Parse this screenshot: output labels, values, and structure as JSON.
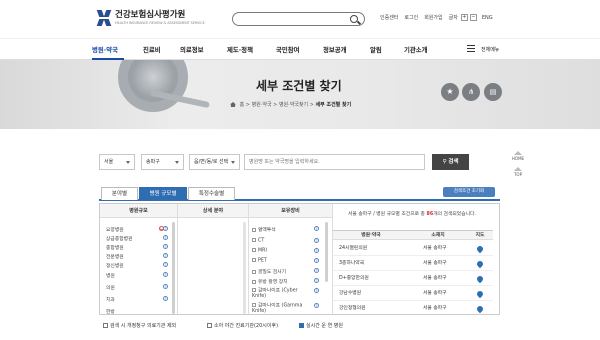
{
  "header": {
    "logo_text": "건강보험심사평가원",
    "logo_sub": "HEALTH INSURANCE REVIEW & ASSESSMENT SERVICE",
    "search_placeholder": "",
    "util": [
      "인증센터",
      "로그인",
      "회원가입",
      "글자"
    ],
    "zoom_plus": "+",
    "zoom_minus": "−",
    "lang": "ENG"
  },
  "nav": {
    "items": [
      "병원·약국",
      "진료비",
      "의료정보",
      "제도·정책",
      "국민참여",
      "정보공개",
      "알림",
      "기관소개"
    ],
    "all_menu": "전체메뉴",
    "active_index": 0
  },
  "banner": {
    "title": "세부 조건별 찾기",
    "breadcrumb": [
      "홈",
      "병원·약국",
      "병원·약국찾기",
      "세부 조건별 찾기"
    ],
    "actions": [
      "star-icon",
      "share-icon",
      "print-icon"
    ]
  },
  "filter": {
    "region1": "서울",
    "region2": "송파구",
    "region3": "읍/면/동/로 선택",
    "keyword_placeholder": "병원명 또는 약국명을 입력하세요.",
    "search_button": "검색"
  },
  "side": {
    "home": "HOME",
    "top": "TOP"
  },
  "tabs": {
    "items": [
      "분야별",
      "병원 규모별",
      "특정수술별"
    ],
    "active_index": 1,
    "reset_button": "검색조건 초기화"
  },
  "panel": {
    "col_headers": [
      "병원규모",
      "상세 분야",
      "보유장비"
    ],
    "sizes": [
      "요양병원",
      "상급종합병원",
      "종합병원",
      "전문병원",
      "정신병원",
      "병원",
      "의원",
      "치과",
      "한방"
    ],
    "equipment": [
      "혈액투석",
      "CT",
      "MRI",
      "PET",
      "골밀도 검사기",
      "유방 촬영 장치",
      "감마나이프 (Cyber Knife)",
      "감마나이프 (Gamma Knife)"
    ],
    "result_text_prefix": "서울 송파구 / 병원 규모별 조건으로 총 ",
    "result_count": "86",
    "result_text_suffix": "개의 검색되었습니다.",
    "result_headers": [
      "병원·약국",
      "소재지",
      "지도"
    ],
    "results": [
      {
        "name": "24시열린의원",
        "addr": "서울 송파구"
      },
      {
        "name": "3층하나약국",
        "addr": "서울 송파구"
      },
      {
        "name": "D+중앙한의원",
        "addr": "서울 송파구"
      },
      {
        "name": "강남수병원",
        "addr": "서울 송파구"
      },
      {
        "name": "강인정형의원",
        "addr": "서울 송파구"
      }
    ]
  },
  "bottom": {
    "opt1": "검색 시 개정청구 의료기관 제외",
    "opt2": "소아 야간 진료기관(20시이후)",
    "opt3": "실시간 운 연 병원",
    "opt3_checked": true
  },
  "colors": {
    "primary": "#2f6db3",
    "nav_active": "#1c4aa3",
    "banner": "#e6e6e6"
  }
}
